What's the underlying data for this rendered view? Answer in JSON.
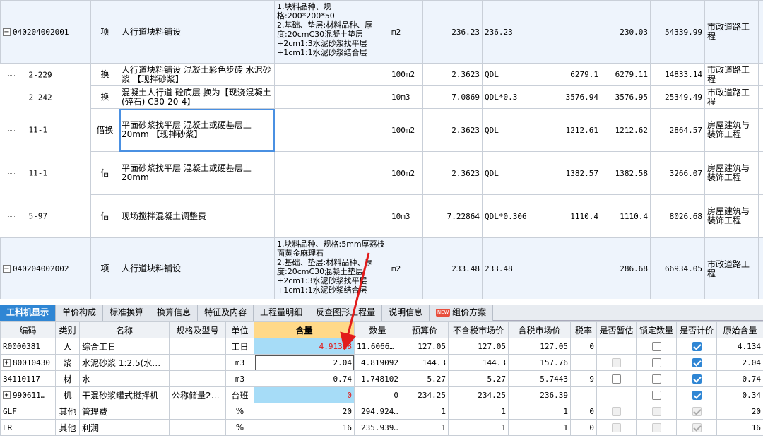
{
  "top_rows": [
    {
      "code": "040204002001",
      "kind": "项",
      "name": "人行道块料铺设",
      "feature": "1.块料品种、规格:200*200*50\n2.基础、垫层:材料品种、厚度:20cmC30混凝土垫层\n+2cm1:3水泥砂浆找平层\n+1cm1:1水泥砂浆结合层",
      "unit": "m2",
      "qty": "236.23",
      "expr": "236.23",
      "price1": "",
      "price2": "230.03",
      "total": "54339.99",
      "major": "市政道路工程"
    },
    {
      "code": "2-229",
      "kind": "换",
      "name": "人行道块料铺设 混凝土彩色步砖 水泥砂浆 【现拌砂浆】",
      "feature": "",
      "unit": "100m2",
      "qty": "2.3623",
      "expr": "QDL",
      "price1": "6279.1",
      "price2": "6279.11",
      "total": "14833.14",
      "major": "市政道路工程"
    },
    {
      "code": "2-242",
      "kind": "换",
      "name": "混凝土人行道 砼底层 换为【现浇混凝土(碎石) C30-20-4】",
      "feature": "",
      "unit": "10m3",
      "qty": "7.0869",
      "expr": "QDL*0.3",
      "price1": "3576.94",
      "price2": "3576.95",
      "total": "25349.49",
      "major": "市政道路工程"
    },
    {
      "code": "11-1",
      "kind": "借换",
      "name": "平面砂浆找平层 混凝土或硬基层上 20mm 【现拌砂浆】",
      "feature": "",
      "unit": "100m2",
      "qty": "2.3623",
      "expr": "QDL",
      "price1": "1212.61",
      "price2": "1212.62",
      "total": "2864.57",
      "major": "房屋建筑与装饰工程"
    },
    {
      "code": "11-1",
      "kind": "借",
      "name": "平面砂浆找平层 混凝土或硬基层上 20mm",
      "feature": "",
      "unit": "100m2",
      "qty": "2.3623",
      "expr": "QDL",
      "price1": "1382.57",
      "price2": "1382.58",
      "total": "3266.07",
      "major": "房屋建筑与装饰工程"
    },
    {
      "code": "5-97",
      "kind": "借",
      "name": "现场搅拌混凝土调整费",
      "feature": "",
      "unit": "10m3",
      "qty": "7.22864",
      "expr": "QDL*0.306",
      "price1": "1110.4",
      "price2": "1110.4",
      "total": "8026.68",
      "major": "房屋建筑与装饰工程"
    },
    {
      "code": "040204002002",
      "kind": "项",
      "name": "人行道块料铺设",
      "feature": "1.块料品种、规格:5mm厚荔枝面黄金麻理石\n2.基础、垫层:材料品种、厚度:20cmC30混凝土垫层\n+2cm1:3水泥砂浆找平层\n+1cm1:1水泥砂浆结合层",
      "unit": "m2",
      "qty": "233.48",
      "expr": "233.48",
      "price1": "",
      "price2": "286.68",
      "total": "66934.05",
      "major": "市政道路工程"
    }
  ],
  "tabs": [
    "工料机显示",
    "单价构成",
    "标准换算",
    "换算信息",
    "特征及内容",
    "工程量明细",
    "反查图形工程量",
    "说明信息",
    "组价方案"
  ],
  "new_badge": "NEW",
  "headers": [
    "编码",
    "类别",
    "名称",
    "规格及型号",
    "单位",
    "含量",
    "数量",
    "预算价",
    "不含税市场价",
    "含税市场价",
    "税率",
    "是否暂估",
    "锁定数量",
    "是否计价",
    "原始含量"
  ],
  "rows": [
    {
      "code": "R0000381",
      "type": "人",
      "name": "综合工日",
      "spec": "",
      "unit": "工日",
      "content": "4.91328",
      "amount": "11.606641",
      "budget": "127.05",
      "mkt": "127.05",
      "mkt_tax": "127.05",
      "tax": "0",
      "orig": "4.134"
    },
    {
      "code": "80010430",
      "type": "浆",
      "name": "水泥砂浆 1:2.5(水…",
      "spec": "",
      "unit": "m3",
      "content": "2.04",
      "amount": "4.819092",
      "budget": "144.3",
      "mkt": "144.3",
      "mkt_tax": "157.76",
      "tax": "",
      "orig": "2.04"
    },
    {
      "code": "34110117",
      "type": "材",
      "name": "水",
      "spec": "",
      "unit": "m3",
      "content": "0.74",
      "amount": "1.748102",
      "budget": "5.27",
      "mkt": "5.27",
      "mkt_tax": "5.7443",
      "tax": "9",
      "orig": "0.74"
    },
    {
      "code": "990611…",
      "type": "机",
      "name": "干混砂浆罐式搅拌机",
      "spec": "公称储量2…",
      "unit": "台班",
      "content": "0",
      "amount": "0",
      "budget": "234.25",
      "mkt": "234.25",
      "mkt_tax": "236.39",
      "tax": "",
      "orig": "0.34"
    },
    {
      "code": "GLF",
      "type": "其他",
      "name": "管理费",
      "spec": "",
      "unit": "%",
      "content": "20",
      "amount": "294.924…",
      "budget": "1",
      "mkt": "1",
      "mkt_tax": "1",
      "tax": "0",
      "orig": "20"
    },
    {
      "code": "LR",
      "type": "其他",
      "name": "利润",
      "spec": "",
      "unit": "%",
      "content": "16",
      "amount": "235.939…",
      "budget": "1",
      "mkt": "1",
      "mkt_tax": "1",
      "tax": "0",
      "orig": "16"
    }
  ],
  "colors": {
    "active_tab": "#2f86d4",
    "content_header": "#ffd989",
    "content_cell": "#a6dcf7",
    "arrow": "#e21b1b"
  }
}
